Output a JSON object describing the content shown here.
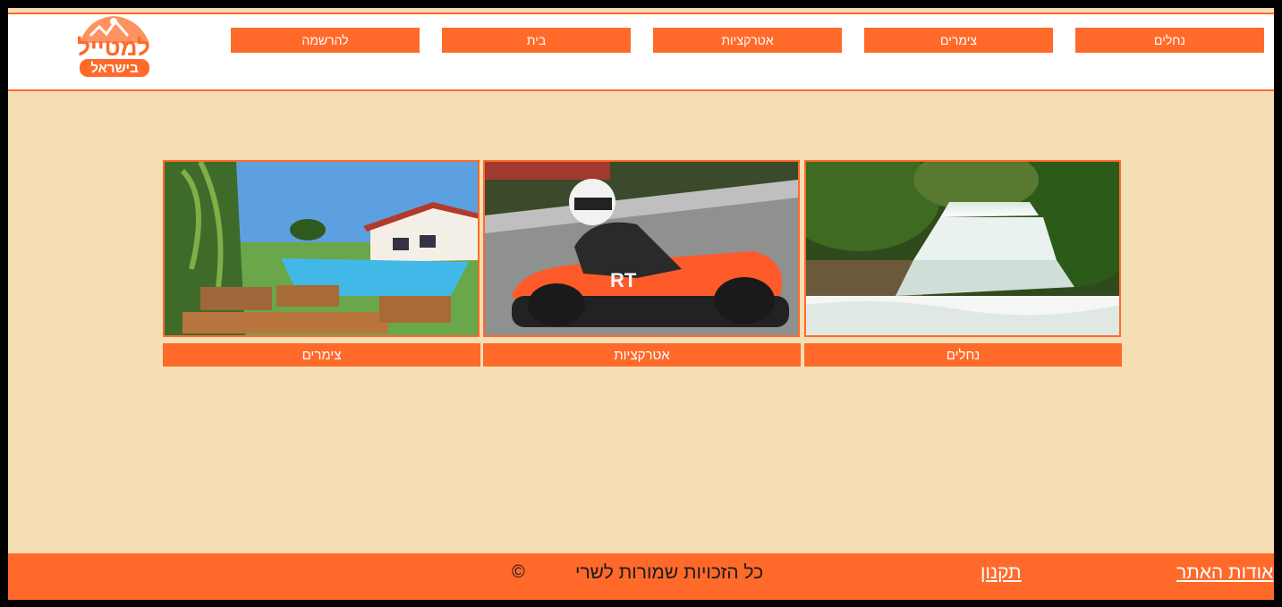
{
  "nav": {
    "items": [
      {
        "label": "נחלים"
      },
      {
        "label": "צימרים"
      },
      {
        "label": "אטרקציות"
      },
      {
        "label": "בית"
      },
      {
        "label": "להרשמה"
      }
    ]
  },
  "logo": {
    "line1": "למטייל",
    "line2": "בישראל"
  },
  "cards": [
    {
      "label": "נחלים"
    },
    {
      "label": "אטרקציות"
    },
    {
      "label": "צימרים"
    }
  ],
  "footer": {
    "about": "אודות האתר",
    "terms": "תקנון",
    "rights": "כל הזכויות שמורות לשרי",
    "copyright": "©"
  },
  "colors": {
    "accent": "#ff6a2b",
    "background": "#f5deb3"
  }
}
